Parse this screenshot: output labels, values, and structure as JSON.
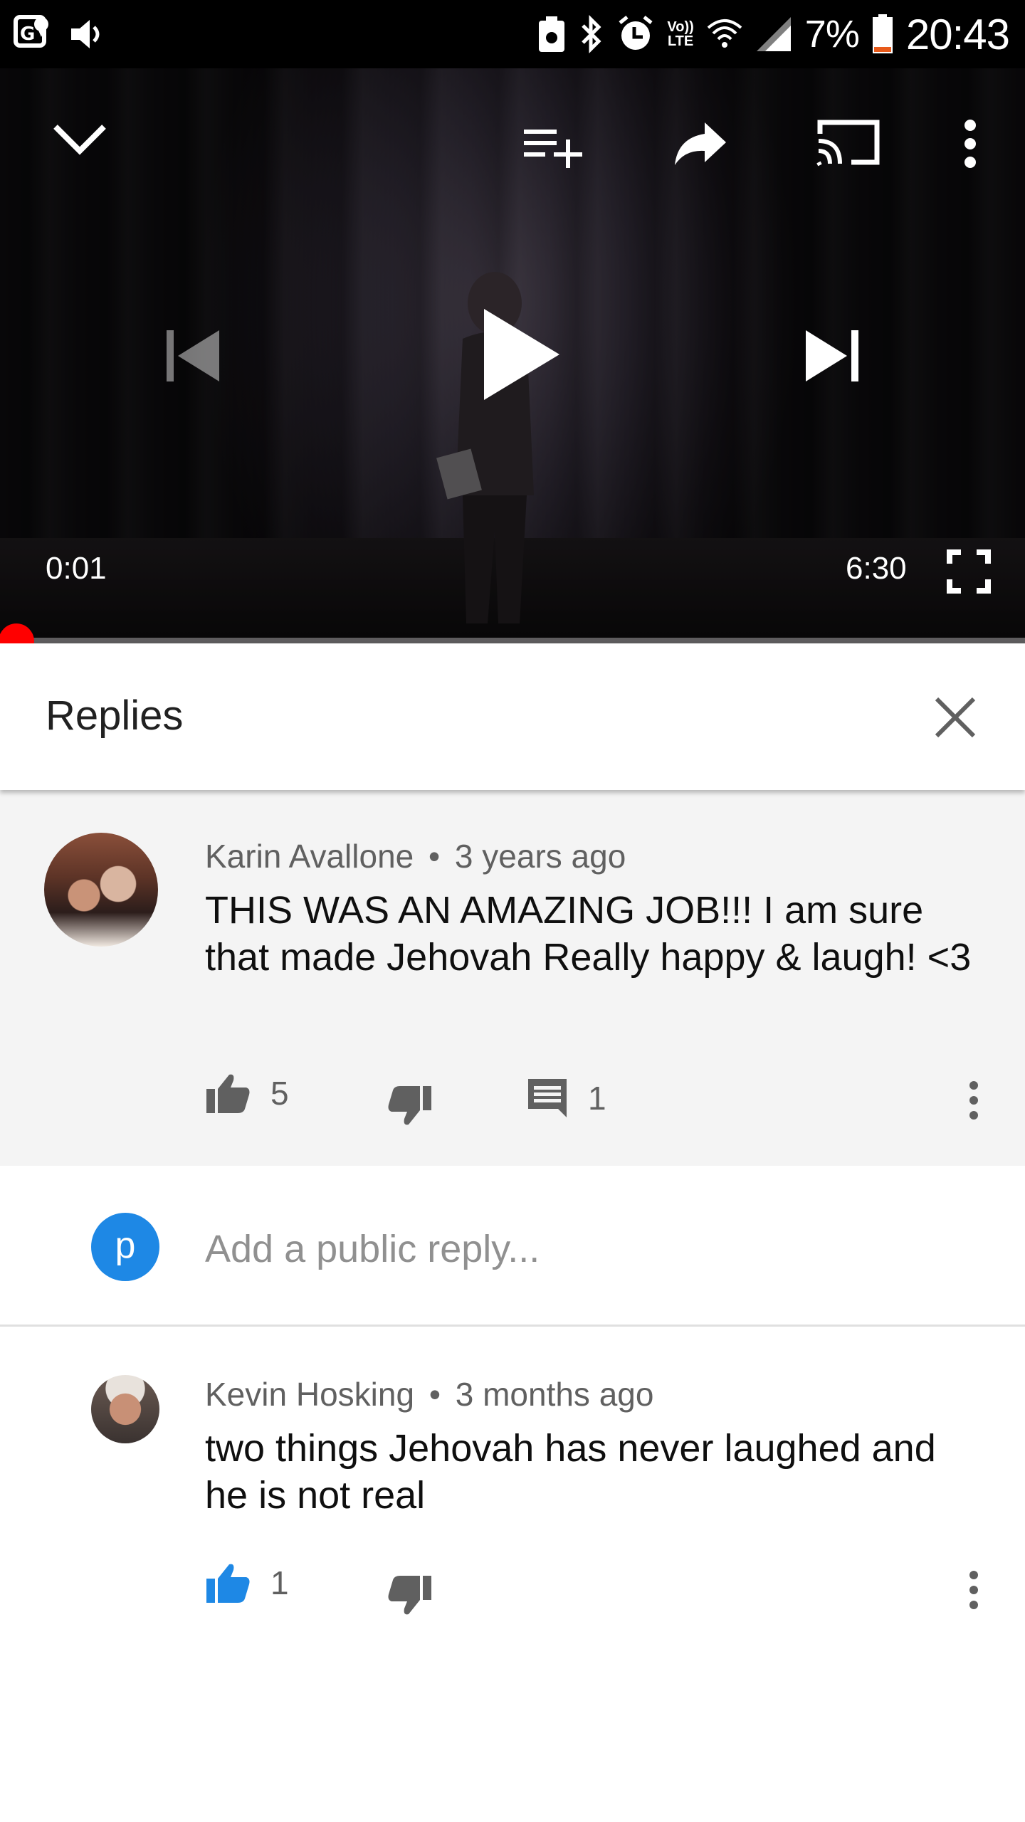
{
  "status_bar": {
    "battery": "7%",
    "time": "20:43",
    "network_label_top": "Vo))",
    "network_label_bottom": "LTE",
    "icons": [
      "gps-icon",
      "volume-icon",
      "app-notification-icon",
      "bluetooth-icon",
      "alarm-icon",
      "volte-icon",
      "wifi-icon",
      "signal-icon",
      "battery-icon"
    ]
  },
  "player": {
    "current_time": "0:01",
    "duration": "6:30",
    "progress_fraction": 0.005,
    "accent_color": "#ff0000",
    "icons": [
      "chevron-down-icon",
      "add-to-queue-icon",
      "share-icon",
      "cast-icon",
      "more-vert-icon",
      "skip-previous-icon",
      "play-icon",
      "skip-next-icon",
      "fullscreen-icon"
    ]
  },
  "replies_panel": {
    "title": "Replies",
    "close_icon": "close-icon"
  },
  "parent_comment": {
    "author": "Karin Avallone",
    "separator": "•",
    "age": "3 years ago",
    "text": "THIS WAS AN AMAZING JOB!!! I am sure that made Jehovah Really happy & laugh! <3",
    "likes": "5",
    "replies_count": "1",
    "liked": false
  },
  "add_reply": {
    "avatar_letter": "p",
    "avatar_color": "#1e88e5",
    "placeholder": "Add a public reply..."
  },
  "reply": {
    "author": "Kevin Hosking",
    "separator": "•",
    "age": "3 months ago",
    "text": "two things Jehovah has never laughed and he is not real",
    "likes": "1",
    "liked": true,
    "like_active_color": "#1e88e5"
  }
}
